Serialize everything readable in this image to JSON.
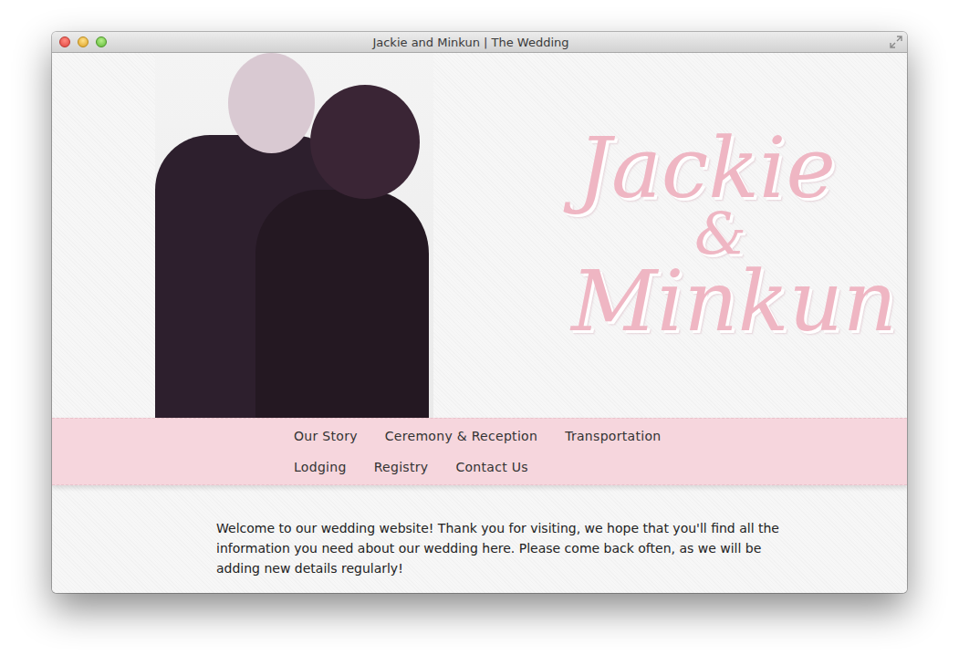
{
  "window": {
    "title": "Jackie and Minkun | The Wedding"
  },
  "logo": {
    "first": "Jackie",
    "amp": "&",
    "second": "Minkun"
  },
  "nav": {
    "rows": [
      [
        "Our Story",
        "Ceremony & Reception",
        "Transportation"
      ],
      [
        "Lodging",
        "Registry",
        "Contact Us"
      ]
    ]
  },
  "intro": "Welcome to our wedding website! Thank you for visiting, we hope that you'll find all the information you need about our wedding here. Please come back often, as we will be adding new details regularly!"
}
